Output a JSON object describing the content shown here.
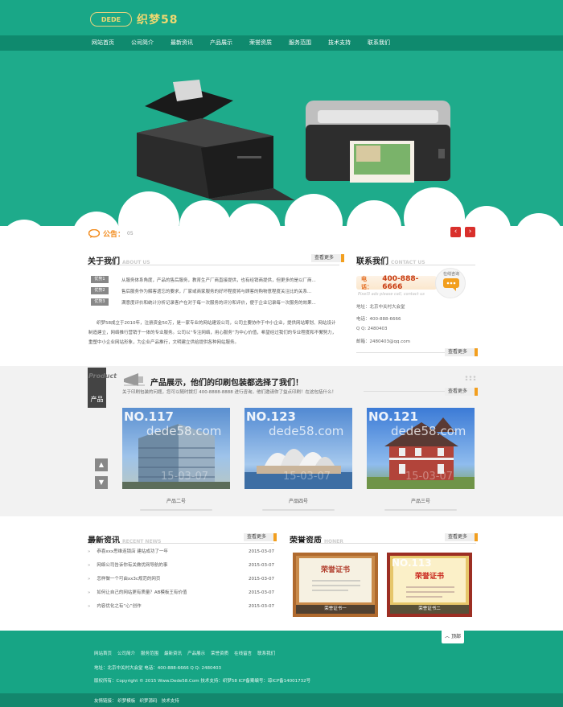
{
  "logo": {
    "badge": "DEDE",
    "name": "织梦58"
  },
  "nav": [
    {
      "label": "网站首页"
    },
    {
      "label": "公司简介"
    },
    {
      "label": "最新资讯"
    },
    {
      "label": "产品展示"
    },
    {
      "label": "荣誉资质"
    },
    {
      "label": "服务范围"
    },
    {
      "label": "技术支持"
    },
    {
      "label": "联系我们"
    }
  ],
  "notice": {
    "label": "公告：",
    "date": "05"
  },
  "about": {
    "title": "关于我们",
    "title_en": "ABOUT US",
    "more": "查看更多",
    "items": [
      {
        "tag": "优势1",
        "text": "从服务体系角度，产品的售后服务，教育生产厂商直接提供，也有经销商提供，但更多的是以厂商..."
      },
      {
        "tag": "优势2",
        "text": "售后服务作为解客遗忘的要求，厂家或商家服务的好坏程度将与顾客的购物意程度关注比的关系..."
      },
      {
        "tag": "优势3",
        "text": "满意度评价和统计分析记录客户在对于每一次服务的评分和评价，便于企业记录每一次服务的效果..."
      }
    ],
    "paragraph": "织梦58成立于2010年，注册资金50万，是一家专业的网站建设公司，公司主要协作于中小企业，提供网站筹划、网站设计制造建立，网络推行营销于一体的专业服务。公司以“专注网络，用心服务”为中心价值，希望经过我们的专业程度和不懈努力，重塑中小企业网站形象，为企业产品推行，文明建立供给提供各种网站服务。"
  },
  "contact": {
    "title": "联系我们",
    "title_en": "CONTACT US",
    "phone_label": "电话：",
    "phone": "400-888-6666",
    "ads_note": "Pixel3 ads please call, contact us",
    "online": "在线咨询",
    "lines": [
      "地址：北京中关村大会堂",
      "电话：400-888-6666",
      "Q Q: 2480403",
      "邮箱：2480403@qq.com"
    ],
    "more": "查看更多"
  },
  "products": {
    "side_en": "Product",
    "side_cn": "产品",
    "title": "产品展示，他们的印刷包装都选择了我们！",
    "subtitle": "关于印刷包装的问题，您可以随时拨打 400-8888-8888 进行咨询，他们邀请你了益点印刷！在这包括什么！",
    "more": "查看更多",
    "items": [
      {
        "no": "NO.117",
        "wm": "dede58.com",
        "date": "15-03-07",
        "caption": "产品二号"
      },
      {
        "no": "NO.123",
        "wm": "dede58.com",
        "date": "15-03-07",
        "caption": "产品四号"
      },
      {
        "no": "NO.121",
        "wm": "dede58.com",
        "date": "15-03-07",
        "caption": "产品三号"
      }
    ]
  },
  "news": {
    "title": "最新资讯",
    "title_en": "RECENT NEWS",
    "more": "查看更多",
    "items": [
      {
        "text": "恭喜xxx思维连锁店 建站成功了一年",
        "date": "2015-03-07"
      },
      {
        "text": "网络公司告诉你有关做优网导航的事",
        "date": "2015-03-07"
      },
      {
        "text": "怎样做一个可由xx3c规范的网页",
        "date": "2015-03-07"
      },
      {
        "text": "如何让自己的网站更有质量？AB模板王有价值",
        "date": "2015-03-07"
      },
      {
        "text": "内容优化之有“心”创作",
        "date": "2015-03-07"
      }
    ]
  },
  "honor": {
    "title": "荣誉资质",
    "title_en": "HONER",
    "more": "查看更多",
    "items": [
      {
        "caption": "荣誉证书一",
        "head": "荣誉证书"
      },
      {
        "caption": "荣誉证书二",
        "head": "荣誉证书",
        "no": "NO.113"
      }
    ]
  },
  "footer": {
    "back_top": "顶部",
    "links": [
      "网站首页",
      "公司简介",
      "服务范围",
      "最新资讯",
      "产品展示",
      "荣誉资质",
      "在线留言",
      "联系我们"
    ],
    "address_line": "地址：北京中关村大会堂    电话：400-888-6666    Q Q: 2480403",
    "copyright_line": "版权所有：Copyright © 2015 Www.Dede58.Com 技术支持：织梦58 ICP备案编号：琼ICP备14001732号",
    "friends_label": "友情链接：",
    "friends": [
      "织梦模板",
      "织梦源码",
      "技术支持"
    ]
  },
  "colors": {
    "brand": "#19a787",
    "nav": "#0f8a6e",
    "accent": "#f29f1f",
    "notice": "#f28a1a",
    "arrow": "#d9302c"
  }
}
